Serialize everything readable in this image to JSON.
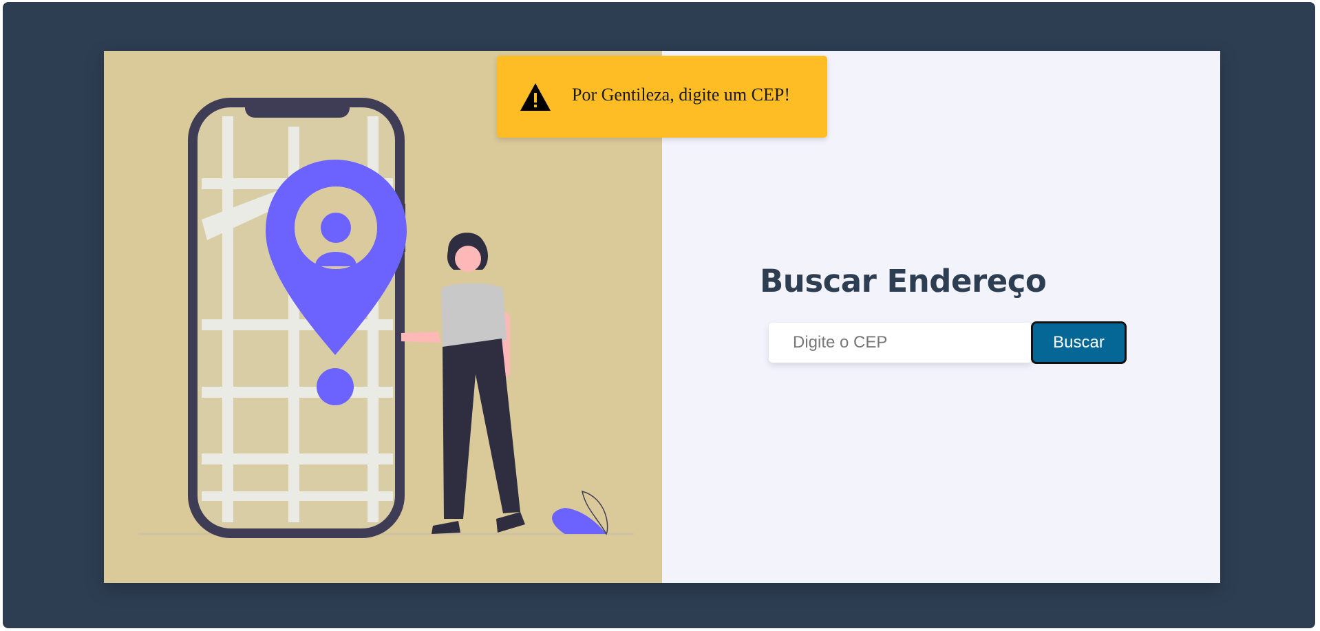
{
  "form": {
    "title": "Buscar Endereço",
    "cep_placeholder": "Digite o CEP",
    "cep_value": "",
    "search_label": "Buscar"
  },
  "alert": {
    "icon": "warning-icon",
    "message": "Por Gentileza, digite um CEP!"
  },
  "illustration": {
    "icons": [
      "phone-map-illustration",
      "location-pin-icon",
      "woman-figure",
      "leaf-icon"
    ]
  },
  "colors": {
    "page_background": "#2e3e52",
    "illustration_background": "#dac999",
    "form_background": "#f3f3fc",
    "accent": "#6c63ff",
    "button": "#056795",
    "alert": "#febc25",
    "title": "#2e3e52"
  }
}
